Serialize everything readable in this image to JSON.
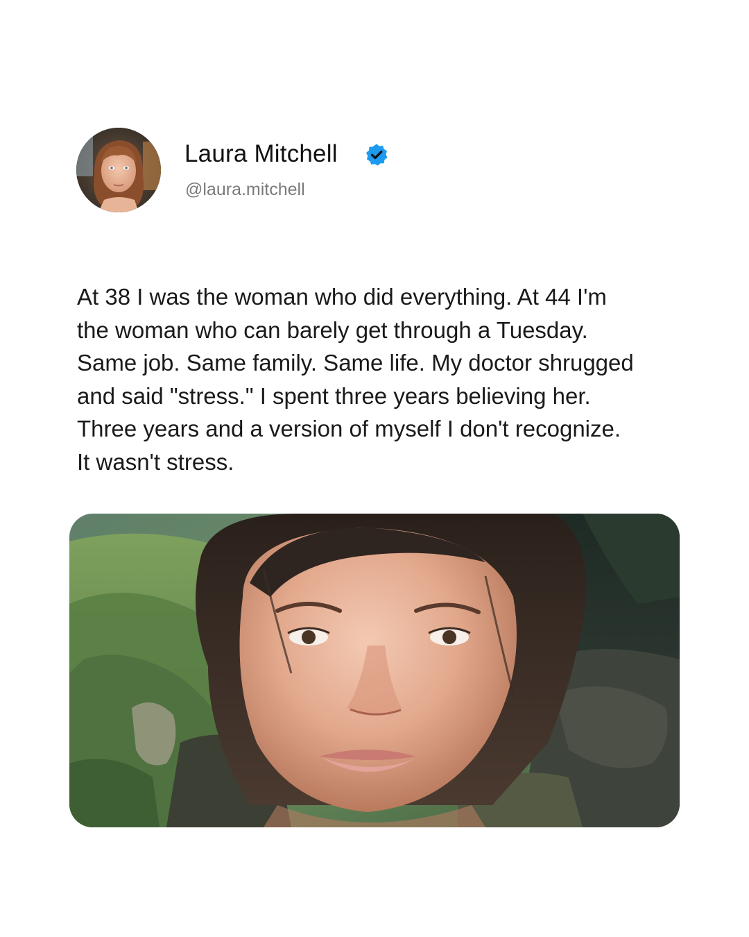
{
  "author": {
    "name": "Laura Mitchell",
    "handle": "@laura.mitchell",
    "verified": true,
    "avatar_icon": "avatar-photo"
  },
  "post": {
    "lines": [
      "At 38 I was the woman who did everything. At 44 I'm",
      "the woman who can barely get through a Tuesday.",
      "Same job. Same family. Same life. My doctor shrugged",
      "and said \"stress.\" I spent three years believing her.",
      "Three years and a version of myself I don't recognize.",
      "It wasn't stress."
    ],
    "image_icon": "selfie-photo"
  },
  "colors": {
    "verified_blue": "#1d9bf0",
    "handle_gray": "#7a7a7a",
    "text": "#1a1a1a"
  }
}
